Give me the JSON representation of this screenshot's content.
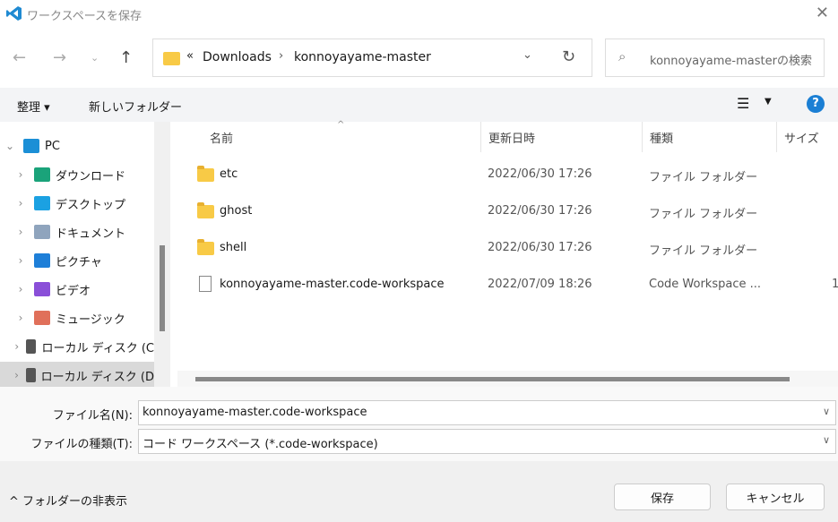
{
  "window": {
    "title": "ワークスペースを保存",
    "close_icon": "close-icon",
    "app_icon": "vscode-icon"
  },
  "nav": {
    "breadcrumb_prefix": "«",
    "path": [
      "Downloads",
      "konnoyayame-master"
    ],
    "search_placeholder": "konnoyayame-masterの検索"
  },
  "toolbar": {
    "organize": "整理",
    "new_folder": "新しいフォルダー",
    "help": "?"
  },
  "sidebar": {
    "items": [
      {
        "label": "PC",
        "icon": "pc-icon",
        "color": "#1b8fd6",
        "expanded": true
      },
      {
        "label": "ダウンロード",
        "icon": "download-icon",
        "color": "#1aa37a"
      },
      {
        "label": "デスクトップ",
        "icon": "desktop-icon",
        "color": "#1ba1e2"
      },
      {
        "label": "ドキュメント",
        "icon": "documents-icon",
        "color": "#8fa4bd"
      },
      {
        "label": "ピクチャ",
        "icon": "pictures-icon",
        "color": "#1e7fd8"
      },
      {
        "label": "ビデオ",
        "icon": "videos-icon",
        "color": "#8a4fd8"
      },
      {
        "label": "ミュージック",
        "icon": "music-icon",
        "color": "#e0705a"
      },
      {
        "label": "ローカル ディスク (C",
        "icon": "drive-icon",
        "color": "#555"
      },
      {
        "label": "ローカル ディスク (D",
        "icon": "drive-icon",
        "color": "#555",
        "selected": true
      }
    ]
  },
  "columns": [
    "名前",
    "更新日時",
    "種類",
    "サイズ"
  ],
  "files": [
    {
      "name": "etc",
      "date": "2022/06/30 17:26",
      "type": "ファイル フォルダー",
      "size": "",
      "kind": "folder"
    },
    {
      "name": "ghost",
      "date": "2022/06/30 17:26",
      "type": "ファイル フォルダー",
      "size": "",
      "kind": "folder"
    },
    {
      "name": "shell",
      "date": "2022/06/30 17:26",
      "type": "ファイル フォルダー",
      "size": "",
      "kind": "folder"
    },
    {
      "name": "konnoyayame-master.code-workspace",
      "date": "2022/07/09 18:26",
      "type": "Code Workspace ...",
      "size": "1",
      "kind": "file"
    }
  ],
  "form": {
    "filename_label": "ファイル名(N):",
    "filename_value": "konnoyayame-master.code-workspace",
    "filetype_label": "ファイルの種類(T):",
    "filetype_value": "コード ワークスペース (*.code-workspace)"
  },
  "footer": {
    "hide_folders": "フォルダーの非表示",
    "save": "保存",
    "cancel": "キャンセル"
  }
}
